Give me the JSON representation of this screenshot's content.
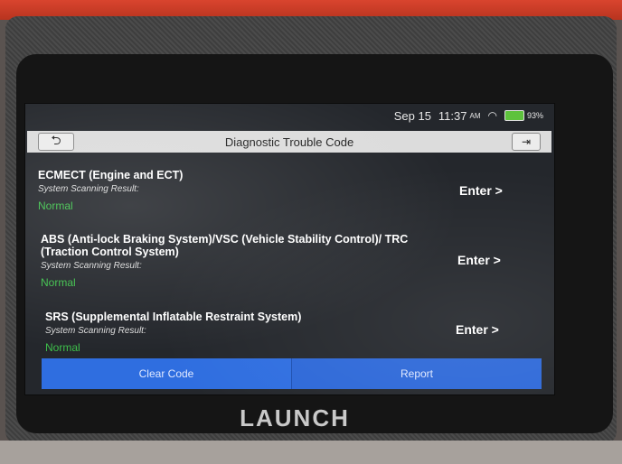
{
  "status_bar": {
    "date": "Sep 15",
    "time": "11:37",
    "ampm": "AM",
    "battery": "93%",
    "wifi_icon": "wifi-icon",
    "battery_color": "#5ec23d"
  },
  "header": {
    "title": "Diagnostic Trouble Code",
    "back_icon": "back-arrow-icon",
    "exit_icon": "exit-icon"
  },
  "systems": [
    {
      "name": "ECMECT (Engine and ECT)",
      "scan_label": "System Scanning Result:",
      "status": "Normal",
      "enter_label": "Enter >"
    },
    {
      "name": "ABS (Anti-lock Braking System)/VSC (Vehicle Stability Control)/ TRC (Traction Control System)",
      "scan_label": "System Scanning Result:",
      "status": "Normal",
      "enter_label": "Enter >"
    },
    {
      "name": "SRS (Supplemental Inflatable Restraint System)",
      "scan_label": "System Scanning Result:",
      "status": "Normal",
      "enter_label": "Enter >"
    }
  ],
  "bottom_bar": {
    "clear_code": "Clear Code",
    "report": "Report",
    "accent_color": "#2f6ee0"
  },
  "device": {
    "brand": "LAUNCH"
  }
}
